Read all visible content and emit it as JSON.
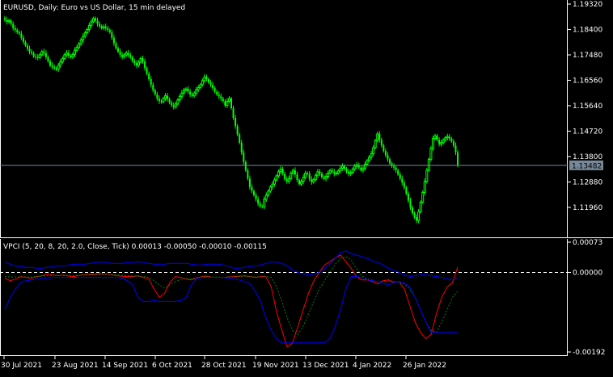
{
  "chart_data": [
    {
      "type": "candlestick",
      "title": "EURUSD, Daily:  Euro vs US Dollar, 15 min delayed",
      "symbol": "EURUSD",
      "timeframe": "Daily",
      "y_ticks": [
        "1.19320",
        "1.18400",
        "1.17480",
        "1.16560",
        "1.15640",
        "1.14720",
        "1.13800",
        "1.12880",
        "1.11960"
      ],
      "ylim": [
        1.1105,
        1.1935
      ],
      "current_price": 1.13482,
      "current_price_label": "1.13482",
      "colors": {
        "bull": "#00ff00",
        "bear": "#00ff00",
        "background": "#000000",
        "axis": "#ffffff",
        "price_line": "#778899"
      },
      "grid": false,
      "closes": [
        1.1875,
        1.1868,
        1.1872,
        1.186,
        1.1845,
        1.1838,
        1.183,
        1.1825,
        1.181,
        1.1795,
        1.1782,
        1.177,
        1.176,
        1.1755,
        1.1742,
        1.174,
        1.1738,
        1.1748,
        1.176,
        1.1755,
        1.174,
        1.1725,
        1.171,
        1.1705,
        1.17,
        1.1695,
        1.171,
        1.1722,
        1.1735,
        1.1748,
        1.1755,
        1.1745,
        1.174,
        1.175,
        1.1765,
        1.1775,
        1.1788,
        1.1802,
        1.1815,
        1.1828,
        1.184,
        1.1855,
        1.1868,
        1.188,
        1.1872,
        1.186,
        1.1852,
        1.1845,
        1.185,
        1.1845,
        1.1838,
        1.183,
        1.181,
        1.179,
        1.1772,
        1.176,
        1.1748,
        1.174,
        1.1748,
        1.1755,
        1.1748,
        1.174,
        1.1725,
        1.1718,
        1.171,
        1.1722,
        1.1735,
        1.1725,
        1.17,
        1.168,
        1.166,
        1.164,
        1.162,
        1.1605,
        1.159,
        1.158,
        1.1578,
        1.159,
        1.16,
        1.1588,
        1.1575,
        1.1565,
        1.156,
        1.157,
        1.1585,
        1.1598,
        1.161,
        1.162,
        1.1625,
        1.1615,
        1.1605,
        1.16,
        1.161,
        1.1622,
        1.163,
        1.164,
        1.1655,
        1.1668,
        1.166,
        1.1648,
        1.164,
        1.1628,
        1.1615,
        1.1605,
        1.1598,
        1.159,
        1.158,
        1.1565,
        1.158,
        1.159,
        1.1555,
        1.152,
        1.149,
        1.146,
        1.143,
        1.1395,
        1.136,
        1.133,
        1.13,
        1.127,
        1.1255,
        1.124,
        1.1225,
        1.121,
        1.12,
        1.1198,
        1.1225,
        1.124,
        1.1255,
        1.127,
        1.128,
        1.1295,
        1.131,
        1.1325,
        1.1335,
        1.1318,
        1.1298,
        1.129,
        1.13,
        1.132,
        1.133,
        1.1315,
        1.1295,
        1.128,
        1.129,
        1.1305,
        1.132,
        1.1318,
        1.1298,
        1.1288,
        1.1296,
        1.1312,
        1.1325,
        1.1318,
        1.1305,
        1.13,
        1.1308,
        1.132,
        1.133,
        1.1325,
        1.1318,
        1.132,
        1.1328,
        1.1338,
        1.1345,
        1.1335,
        1.1325,
        1.1318,
        1.1322,
        1.1335,
        1.1345,
        1.135,
        1.134,
        1.133,
        1.1338,
        1.1352,
        1.1365,
        1.1378,
        1.139,
        1.1412,
        1.1438,
        1.1462,
        1.144,
        1.142,
        1.14,
        1.1385,
        1.137,
        1.1355,
        1.1345,
        1.134,
        1.133,
        1.1315,
        1.13,
        1.1285,
        1.1268,
        1.1245,
        1.122,
        1.1195,
        1.1175,
        1.116,
        1.1148,
        1.118,
        1.1215,
        1.125,
        1.129,
        1.133,
        1.137,
        1.141,
        1.1445,
        1.1455,
        1.144,
        1.1425,
        1.143,
        1.144,
        1.1448,
        1.1452,
        1.1445,
        1.1435,
        1.142,
        1.1395,
        1.1348
      ]
    },
    {
      "type": "line",
      "title": "VPCI (5, 20, 8, 20, 2.0, Close, Tick) 0.00013 -0.00050 -0.00010 -0.00115",
      "y_ticks": [
        "0.00073",
        "0.00000",
        "-0.00192"
      ],
      "ylim": [
        -0.00192,
        0.00073
      ],
      "zero_line": 0.0,
      "x_ticks": [
        "30 Jul 2021",
        "23 Aug 2021",
        "14 Sep 2021",
        "6 Oct 2021",
        "28 Oct 2021",
        "19 Nov 2021",
        "13 Dec 2021",
        "4 Jan 2022",
        "26 Jan 2022"
      ],
      "colors": {
        "vpci": "#ff0000",
        "signal": "#008000",
        "upper": "#0000ff",
        "lower": "#0000ff",
        "zero": "#ffffff"
      },
      "series": [
        {
          "key": "vpci",
          "values": [
            -0.00014,
            -0.0002,
            -0.00016,
            -0.0001,
            -0.00012,
            -0.00014,
            -0.0001,
            -8e-05,
            -4e-05,
            -6e-05,
            -8e-05,
            -6e-05,
            -9e-05,
            -0.0001,
            -7e-05,
            -5e-05,
            -4e-05,
            -4e-05,
            -3e-05,
            -4e-05,
            -6e-05,
            -8e-05,
            -9e-05,
            -0.0001,
            -0.0001,
            -8e-05,
            -0.00012,
            -0.00016,
            -0.0004,
            -0.0006,
            -0.0005,
            -0.00024,
            -0.0001,
            -0.00012,
            -0.00016,
            -0.00018,
            -0.00014,
            -0.0001,
            -9e-05,
            -0.00012,
            -0.00012,
            -0.00012,
            -0.00011,
            -0.0001,
            -9e-05,
            -8e-05,
            -0.0001,
            -0.00012,
            -0.0001,
            -0.0001,
            -0.00035,
            -0.00095,
            -0.0014,
            -0.0018,
            -0.0017,
            -0.0013,
            -0.0009,
            -0.0005,
            -0.0002,
            0.0,
            0.00018,
            0.00026,
            0.00035,
            0.00042,
            0.00026,
            0.0001,
            -0.0001,
            -0.00018,
            -0.00018,
            -0.00022,
            -0.00028,
            -0.0002,
            -0.00018,
            -0.00024,
            -0.00022,
            -0.0004,
            -0.0008,
            -0.0012,
            -0.00145,
            -0.0016,
            -0.0015,
            -0.001,
            -0.0006,
            -0.00035,
            -0.00025,
            0.00013
          ]
        },
        {
          "key": "signal",
          "values": [
            -0.0001,
            -0.00011,
            -0.00011,
            -0.00011,
            -0.00011,
            -0.00011,
            -0.0001,
            -9e-05,
            -8e-05,
            -7e-05,
            -7e-05,
            -7e-05,
            -7e-05,
            -7e-05,
            -7e-05,
            -6e-05,
            -6e-05,
            -6e-05,
            -5e-05,
            -5e-05,
            -5e-05,
            -6e-05,
            -7e-05,
            -8e-05,
            -9e-05,
            -9e-05,
            -0.0001,
            -0.00012,
            -0.0002,
            -0.0003,
            -0.00038,
            -0.0003,
            -0.00022,
            -0.00017,
            -0.00015,
            -0.00015,
            -0.00013,
            -0.00011,
            -0.0001,
            -0.00011,
            -0.00011,
            -0.00012,
            -0.00011,
            -0.00011,
            -0.0001,
            -9e-05,
            -0.0001,
            -0.00011,
            -0.00011,
            -0.0001,
            -0.00012,
            -0.00035,
            -0.0007,
            -0.0011,
            -0.0014,
            -0.0015,
            -0.0013,
            -0.001,
            -0.0007,
            -0.0004,
            -0.0002,
            0.0,
            0.0002,
            0.00033,
            0.00038,
            0.0003,
            0.0001,
            -8e-05,
            -0.00016,
            -0.00019,
            -0.00023,
            -0.00023,
            -0.00021,
            -0.00022,
            -0.00023,
            -0.00028,
            -0.0004,
            -0.0006,
            -0.0009,
            -0.0012,
            -0.0014,
            -0.00145,
            -0.0012,
            -0.0009,
            -0.0006,
            -0.00045
          ]
        },
        {
          "key": "upper",
          "values": [
            0.00024,
            0.0002,
            0.00016,
            0.00014,
            0.00012,
            0.00012,
            0.0001,
            0.0001,
            0.00012,
            0.00014,
            0.00016,
            0.00016,
            0.00018,
            0.0002,
            0.0002,
            0.0002,
            0.00022,
            0.00024,
            0.00025,
            0.00024,
            0.00022,
            0.00022,
            0.00022,
            0.00024,
            0.00024,
            0.00026,
            0.00024,
            0.00022,
            0.0002,
            0.0002,
            0.0002,
            0.00022,
            0.00022,
            0.00022,
            0.00022,
            0.0002,
            0.00018,
            0.00018,
            0.0002,
            0.0002,
            0.0002,
            0.00018,
            0.00015,
            0.0001,
            0.0001,
            0.00012,
            0.00014,
            0.00016,
            0.00018,
            0.00022,
            0.00026,
            0.00025,
            0.00022,
            0.00016,
            6e-05,
            0.0,
            -4e-05,
            -4e-05,
            -4e-05,
            0.0,
            0.0001,
            0.0002,
            0.00034,
            0.00048,
            0.00052,
            0.00046,
            0.00042,
            0.00038,
            0.00034,
            0.00028,
            0.00024,
            0.00018,
            0.0001,
            5e-05,
            0.0,
            -6e-05,
            -0.0001,
            -8e-05,
            -6e-05,
            -6e-05,
            -8e-05,
            -0.0001,
            -0.00012,
            -0.00015,
            -0.00018,
            -0.00015
          ]
        },
        {
          "key": "lower",
          "values": [
            -0.0009,
            -0.0006,
            -0.0004,
            -0.00024,
            -0.0002,
            -0.00018,
            -0.00016,
            -0.00014,
            -0.00014,
            -0.00012,
            -0.00012,
            -0.00012,
            -0.00012,
            -0.00012,
            -0.00012,
            -0.00012,
            -0.00012,
            -0.00012,
            -0.00012,
            -0.00012,
            -0.00012,
            -0.00012,
            -0.00014,
            -0.0002,
            -0.0003,
            -0.0006,
            -0.0007,
            -0.0007,
            -0.00068,
            -0.0007,
            -0.0007,
            -0.0007,
            -0.0007,
            -0.00068,
            -0.0006,
            -0.0003,
            -0.00015,
            -0.00012,
            -0.00012,
            -0.00012,
            -0.00012,
            -0.00012,
            -0.00014,
            -0.00016,
            -0.00018,
            -0.00022,
            -0.00028,
            -0.00045,
            -0.0007,
            -0.0011,
            -0.0014,
            -0.0016,
            -0.0017,
            -0.0017,
            -0.0017,
            -0.0017,
            -0.0017,
            -0.0017,
            -0.0017,
            -0.0017,
            -0.0017,
            -0.0016,
            -0.0013,
            -0.0009,
            -0.0004,
            -0.0001,
            -0.0001,
            -0.00012,
            -0.00018,
            -0.0002,
            -0.00022,
            -0.00026,
            -0.0003,
            -0.00024,
            -0.00022,
            -0.00026,
            -0.00035,
            -0.0006,
            -0.0009,
            -0.0012,
            -0.00145,
            -0.00145,
            -0.00145,
            -0.00145,
            -0.00145,
            -0.00145
          ]
        }
      ]
    }
  ]
}
